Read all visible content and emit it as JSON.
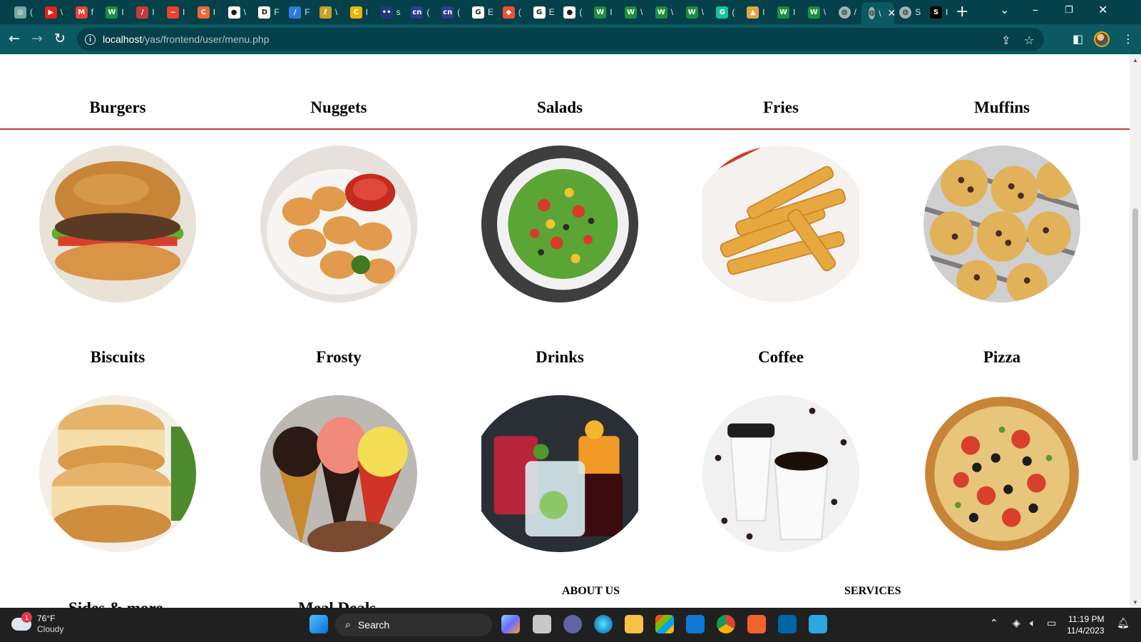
{
  "browser": {
    "tabs": [
      {
        "icon": "openai-icon",
        "title": "(",
        "color": "#7aa6a0"
      },
      {
        "icon": "youtube-icon",
        "title": "\\",
        "color": "#e62117"
      },
      {
        "icon": "gmail-icon",
        "title": "f",
        "color": "#ea4335"
      },
      {
        "icon": "w-icon",
        "title": "I",
        "color": "#1e8e3e"
      },
      {
        "icon": "stripes-icon",
        "title": "I",
        "color": "#c83a3a"
      },
      {
        "icon": "swirl-icon",
        "title": "I",
        "color": "#e8422c"
      },
      {
        "icon": "c-square-icon",
        "title": "I",
        "color": "#ef6a3a"
      },
      {
        "icon": "github-icon",
        "title": "\\",
        "color": "#ffffff"
      },
      {
        "icon": "d-box-icon",
        "title": "F",
        "color": "#ffffff"
      },
      {
        "icon": "slash-icon",
        "title": "F",
        "color": "#2d7be0"
      },
      {
        "icon": "leaf-icon",
        "title": "\\",
        "color": "#c9a227"
      },
      {
        "icon": "c-circle-icon",
        "title": "I",
        "color": "#f2b400"
      },
      {
        "icon": "dots-icon",
        "title": "s",
        "color": "#1f3a7a"
      },
      {
        "icon": "cn-icon",
        "title": "(",
        "color": "#2b3f8a"
      },
      {
        "icon": "cn-icon",
        "title": "(",
        "color": "#2b3f8a"
      },
      {
        "icon": "google-icon",
        "title": "E",
        "color": "#ffffff"
      },
      {
        "icon": "git-icon",
        "title": "(",
        "color": "#f05033"
      },
      {
        "icon": "google-icon",
        "title": "E",
        "color": "#ffffff"
      },
      {
        "icon": "github-icon",
        "title": "(",
        "color": "#ffffff"
      },
      {
        "icon": "w-icon",
        "title": "I",
        "color": "#1e8e3e"
      },
      {
        "icon": "w-icon",
        "title": "\\",
        "color": "#1e8e3e"
      },
      {
        "icon": "w-icon",
        "title": "\\",
        "color": "#1e8e3e"
      },
      {
        "icon": "w-icon",
        "title": "\\",
        "color": "#1e8e3e"
      },
      {
        "icon": "grammarly-icon",
        "title": "(",
        "color": "#15c39a"
      },
      {
        "icon": "mountain-icon",
        "title": "I",
        "color": "#e8a33c"
      },
      {
        "icon": "w-icon",
        "title": "I",
        "color": "#1e8e3e"
      },
      {
        "icon": "w-icon",
        "title": "\\",
        "color": "#1e8e3e"
      },
      {
        "icon": "globe-icon",
        "title": "/",
        "color": "#9fb4b7"
      },
      {
        "icon": "globe-icon",
        "title": "\\",
        "color": "#9fb4b7",
        "active": true
      },
      {
        "icon": "globe-icon",
        "title": "S",
        "color": "#9fb4b7"
      },
      {
        "icon": "sot-icon",
        "title": "I",
        "color": "#000000"
      }
    ],
    "new_tab": "+",
    "url_host": "localhost",
    "url_path": "/yas/frontend/user/menu.php"
  },
  "menu": {
    "row1": [
      {
        "name": "Burgers",
        "image": "burger-image"
      },
      {
        "name": "Nuggets",
        "image": "nuggets-image"
      },
      {
        "name": "Salads",
        "image": "salad-image"
      },
      {
        "name": "Fries",
        "image": "fries-image"
      },
      {
        "name": "Muffins",
        "image": "muffins-image"
      }
    ],
    "row2": [
      {
        "name": "Biscuits",
        "image": "biscuits-image"
      },
      {
        "name": "Frosty",
        "image": "frosty-image"
      },
      {
        "name": "Drinks",
        "image": "drinks-image"
      },
      {
        "name": "Coffee",
        "image": "coffee-image"
      },
      {
        "name": "Pizza",
        "image": "pizza-image"
      }
    ],
    "peek": [
      "Sides & more",
      "Meal Deals"
    ],
    "footer": {
      "about": "ABOUT US",
      "services": "SERVICES"
    },
    "divider_color": "#b53a3a"
  },
  "taskbar": {
    "weather_temp": "76°F",
    "weather_cond": "Cloudy",
    "weather_badge": "1",
    "search_label": "Search",
    "time": "11:19 PM",
    "date": "11/4/2023"
  }
}
